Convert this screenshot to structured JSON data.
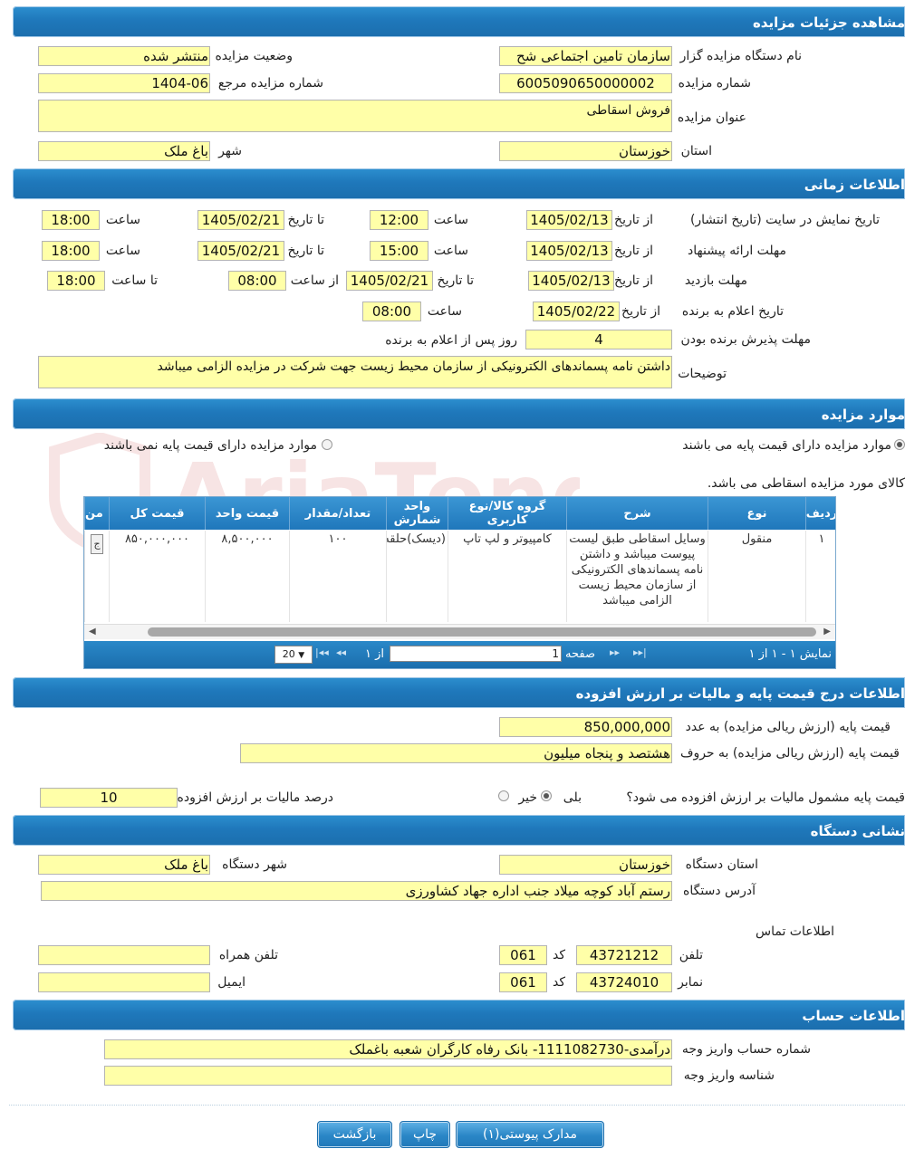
{
  "sections": {
    "details": "مشاهده جزئیات مزایده",
    "time": "اطلاعات زمانی",
    "items": "موارد مزایده",
    "price": "اطلاعات درج قیمت پایه و مالیات بر ارزش افزوده",
    "address": "نشانی دستگاه",
    "account": "اطلاعات حساب"
  },
  "details": {
    "org_label": "نام دستگاه مزایده گزار",
    "org_value": "سازمان تامین اجتماعی شح",
    "status_label": "وضعیت مزایده",
    "status_value": "منتشر شده",
    "number_label": "شماره مزایده",
    "number_value": "6005090650000002",
    "ref_label": "شماره مزایده مرجع",
    "ref_value": "1404-06",
    "title_label": "عنوان مزایده",
    "title_value": "فروش اسقاطی",
    "province_label": "استان",
    "province_value": "خوزستان",
    "city_label": "شهر",
    "city_value": "باغ ملک"
  },
  "time": {
    "display_label": "تاریخ نمایش در سایت (تاریخ انتشار)",
    "from_date_label": "از تاریخ",
    "to_date_label": "تا تاریخ",
    "hour_label": "ساعت",
    "from_hour_label": "از ساعت",
    "to_hour_label": "تا ساعت",
    "display_from_date": "1405/02/13",
    "display_from_time": "12:00",
    "display_to_date": "1405/02/21",
    "display_to_time": "18:00",
    "offer_label": "مهلت ارائه پیشنهاد",
    "offer_from_date": "1405/02/13",
    "offer_from_time": "15:00",
    "offer_to_date": "1405/02/21",
    "offer_to_time": "18:00",
    "visit_label": "مهلت بازدید",
    "visit_from_date": "1405/02/13",
    "visit_to_date": "1405/02/21",
    "visit_from_time": "08:00",
    "visit_to_time": "18:00",
    "winner_label": "تاریخ اعلام به برنده",
    "winner_date": "1405/02/22",
    "winner_time": "08:00",
    "accept_label": "مهلت پذیرش برنده بودن",
    "accept_value": "4",
    "accept_suffix": "روز پس از اعلام به برنده",
    "desc_label": "توضیحات",
    "desc_value": "داشتن نامه پسماندهای الکترونیکی از سازمان محیط زیست جهت شرکت در مزایده الزامی میباشد"
  },
  "items": {
    "radio_with_price": "موارد مزایده دارای قیمت پایه می باشند",
    "radio_without_price": "موارد مزایده دارای قیمت پایه نمی باشند",
    "scrap_note": "کالای مورد مزایده اسقاطی می باشد.",
    "columns": [
      "ردیف",
      "نوع",
      "شرح",
      "گروه کالا/نوع کاربری",
      "واحد شمارش",
      "تعداد/مقدار",
      "قیمت واحد",
      "قیمت کل",
      "من"
    ],
    "row": [
      "۱",
      "منقول",
      "وسایل اسقاطی طبق لیست پیوست میباشد و داشتن نامه پسماندهای الکترونیکی از سازمان محیط زیست الزامی میباشد",
      "کامپیوتر و لپ تاپ",
      "(دیسک)حلقه",
      "۱۰۰",
      "۸,۵۰۰,۰۰۰",
      "۸۵۰,۰۰۰,۰۰۰",
      "ج"
    ],
    "pager": {
      "display": "نمایش ۱ - ۱ از ۱",
      "page_label": "صفحه",
      "page_value": "1",
      "of_label": "از ۱",
      "page_size": "20"
    }
  },
  "price": {
    "base_num_label": "قیمت پایه (ارزش ریالی مزایده) به عدد",
    "base_num_value": "850,000,000",
    "base_text_label": "قیمت پایه (ارزش ریالی مزایده) به حروف",
    "base_text_value": "هشتصد و پنجاه میلیون",
    "vat_q_label": "قیمت پایه مشمول مالیات بر ارزش افزوده می شود؟",
    "yes_label": "بلی",
    "no_label": "خیر",
    "vat_pct_label": "درصد مالیات بر ارزش افزوده",
    "vat_pct_value": "10"
  },
  "address": {
    "province_label": "استان دستگاه",
    "province_value": "خوزستان",
    "city_label": "شهر دستگاه",
    "city_value": "باغ ملک",
    "addr_label": "آدرس دستگاه",
    "addr_value": "رستم آباد کوچه میلاد جنب اداره جهاد کشاورزی",
    "contact_label": "اطلاعات تماس",
    "phone_label": "تلفن",
    "phone_value": "43721212",
    "code_label": "کد",
    "phone_code": "061",
    "mobile_label": "تلفن همراه",
    "fax_label": "نمابر",
    "fax_value": "43724010",
    "fax_code": "061",
    "email_label": "ایمیل"
  },
  "account": {
    "acc_label": "شماره حساب واریز وجه",
    "acc_value": "درآمدی-1111082730- بانک رفاه کارگران شعبه باغملک",
    "sheba_label": "شناسه واریز وجه"
  },
  "buttons": {
    "docs": "مدارک پیوستی(۱)",
    "print": "چاپ",
    "back": "بازگشت"
  },
  "watermark": "AriaTender.net",
  "colors": {
    "bar": "#1f78bb",
    "field": "#ffffa8"
  }
}
